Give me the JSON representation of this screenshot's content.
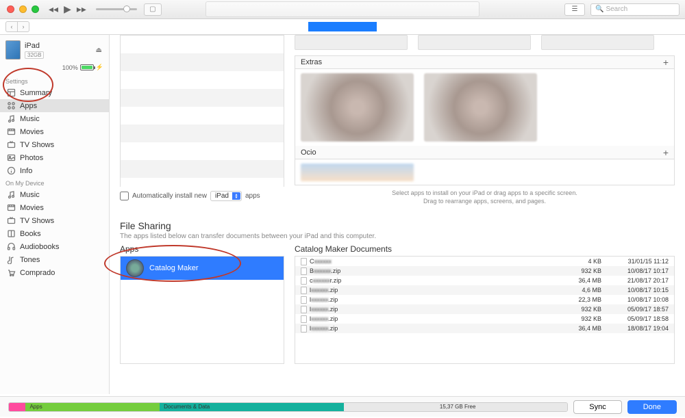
{
  "titlebar": {
    "search_placeholder": "Search"
  },
  "device": {
    "name": "iPad",
    "capacity": "32GB",
    "battery_pct": "100%"
  },
  "sidebar": {
    "settings_head": "Settings",
    "settings": [
      "Summary",
      "Apps",
      "Music",
      "Movies",
      "TV Shows",
      "Photos",
      "Info"
    ],
    "onmydevice_head": "On My Device",
    "onmydevice": [
      "Music",
      "Movies",
      "TV Shows",
      "Books",
      "Audiobooks",
      "Tones",
      "Comprado"
    ]
  },
  "auto_install": {
    "label": "Automatically install new",
    "target": "iPad",
    "suffix": "apps"
  },
  "extras": {
    "label": "Extras",
    "ocio": "Ocio"
  },
  "hint": {
    "line1": "Select apps to install on your iPad or drag apps to a specific screen.",
    "line2": "Drag to rearrange apps, screens, and pages."
  },
  "file_sharing": {
    "title": "File Sharing",
    "subtitle": "The apps listed below can transfer documents between your iPad and this computer.",
    "apps_label": "Apps",
    "docs_label": "Catalog Maker Documents",
    "app_selected": "Catalog Maker",
    "docs": [
      {
        "name": "C",
        "ext": "",
        "size": "4 KB",
        "date": "31/01/15 11:12"
      },
      {
        "name": "B",
        "ext": ".zip",
        "size": "932 KB",
        "date": "10/08/17 10:17"
      },
      {
        "name": "c",
        "ext": "r.zip",
        "size": "36,4 MB",
        "date": "21/08/17 20:17"
      },
      {
        "name": "l",
        "ext": ".zip",
        "size": "4,6 MB",
        "date": "10/08/17 10:15"
      },
      {
        "name": "l",
        "ext": ".zip",
        "size": "22,3 MB",
        "date": "10/08/17 10:08"
      },
      {
        "name": "l",
        "ext": ".zip",
        "size": "932 KB",
        "date": "05/09/17 18:57"
      },
      {
        "name": "l",
        "ext": ".zip",
        "size": "932 KB",
        "date": "05/09/17 18:58"
      },
      {
        "name": "l",
        "ext": ".zip",
        "size": "36,4 MB",
        "date": "18/08/17 19:04"
      }
    ]
  },
  "footer": {
    "apps": "Apps",
    "docsdata": "Documents & Data",
    "free": "15,37 GB Free",
    "sync": "Sync",
    "done": "Done"
  }
}
